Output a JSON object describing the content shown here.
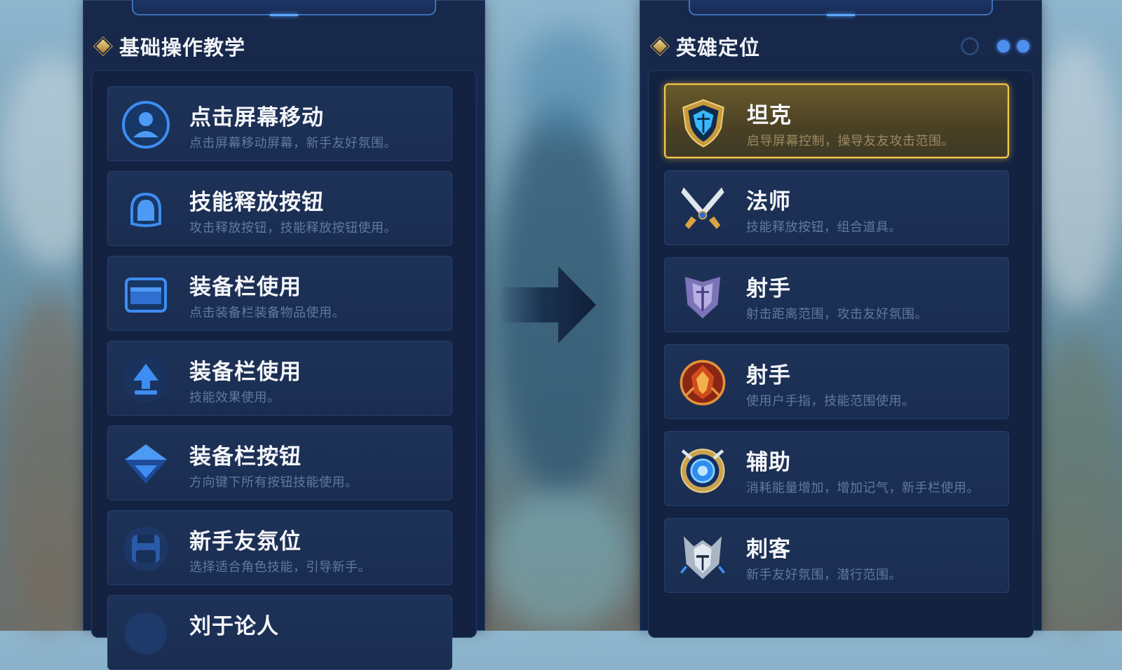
{
  "left_panel": {
    "title": "基础操作教学",
    "items": [
      {
        "title": "点击屏幕移动",
        "desc": "点击屏幕移动屏幕，新手友好氛围。",
        "icon": "user-circle-icon"
      },
      {
        "title": "技能释放按钮",
        "desc": "攻击释放按钮，技能释放按钮使用。",
        "icon": "bell-icon"
      },
      {
        "title": "装备栏使用",
        "desc": "点击装备栏装备物品使用。",
        "icon": "card-icon"
      },
      {
        "title": "装备栏使用",
        "desc": "技能效果使用。",
        "icon": "spade-icon"
      },
      {
        "title": "装备栏按钮",
        "desc": "方向键下所有按钮技能使用。",
        "icon": "shield-chevron-icon"
      },
      {
        "title": "新手友氛位",
        "desc": "选择适合角色技能，引导新手。",
        "icon": "floppy-icon"
      },
      {
        "title": "刘于论人",
        "desc": "",
        "icon": "circle-icon"
      }
    ]
  },
  "right_panel": {
    "title": "英雄定位",
    "items": [
      {
        "title": "坦克",
        "desc": "启导屏幕控制，操导友友攻击范围。",
        "icon": "tank-shield-icon",
        "selected": true
      },
      {
        "title": "法师",
        "desc": "技能释放按钮，组合道具。",
        "icon": "crossed-swords-icon"
      },
      {
        "title": "射手",
        "desc": "射击距离范围，攻击友好氛围。",
        "icon": "armored-helm-icon"
      },
      {
        "title": "射手",
        "desc": "使用户手指，技能范围使用。",
        "icon": "red-crest-icon"
      },
      {
        "title": "辅助",
        "desc": "消耗能量增加，增加记气，新手栏使用。",
        "icon": "blue-orb-icon"
      },
      {
        "title": "刺客",
        "desc": "新手友好氛围，潜行范围。",
        "icon": "knight-helm-icon"
      }
    ]
  },
  "colors": {
    "panel_bg": "#17284a",
    "card_bg": "#1e3258",
    "accent_blue": "#4d8ff0",
    "gold": "#f2c84f"
  }
}
